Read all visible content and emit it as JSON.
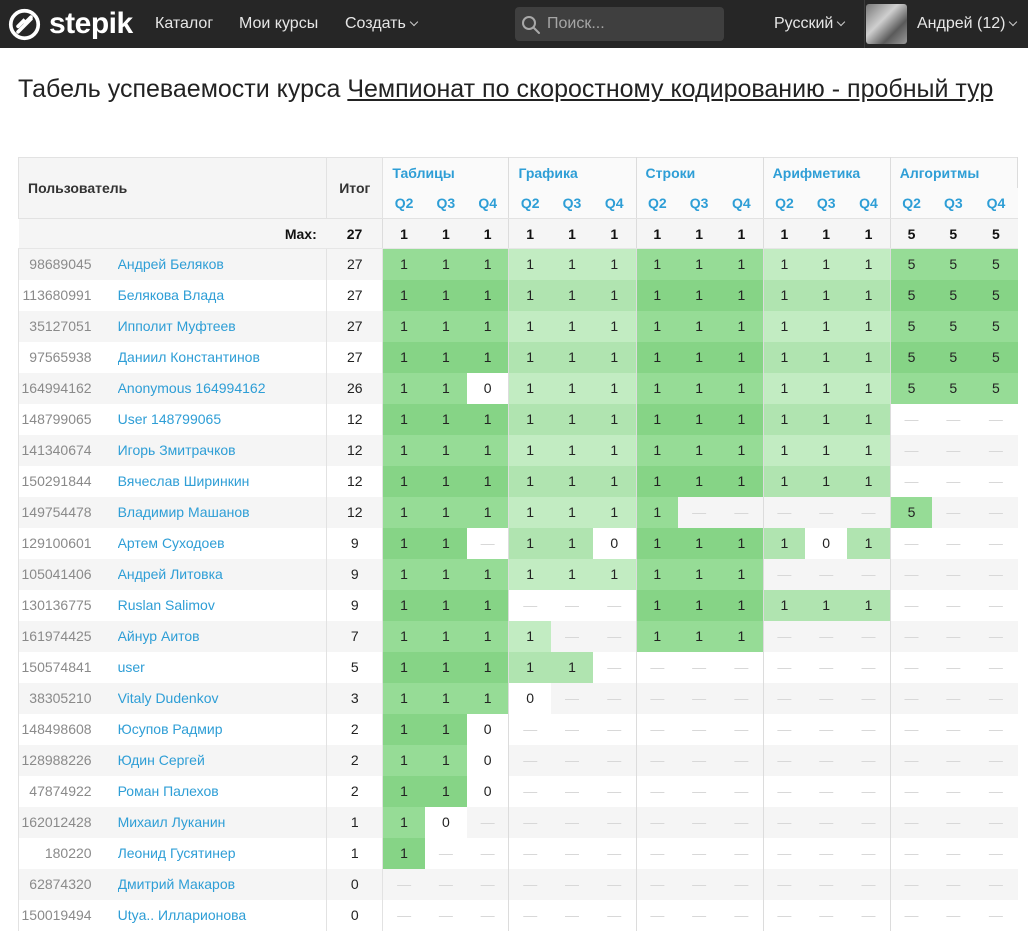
{
  "header": {
    "logo_text": "stepik",
    "nav": {
      "catalog": "Каталог",
      "my_courses": "Мои курсы",
      "create": "Создать"
    },
    "search": {
      "placeholder": "Поиск..."
    },
    "language": "Русский",
    "user_name": "Андрей (12)"
  },
  "page": {
    "title_prefix": "Табель успеваемости курса ",
    "course_title": "Чемпионат по скоростному кодированию - пробный тур"
  },
  "table": {
    "col_user": "Пользователь",
    "col_total": "Итог",
    "max_label": "Max:",
    "max_total": "27",
    "empty_mark": "—",
    "modules": [
      {
        "name": "Таблицы",
        "steps": [
          "Q2",
          "Q3",
          "Q4"
        ],
        "max": [
          "1",
          "1",
          "1"
        ]
      },
      {
        "name": "Графика",
        "steps": [
          "Q2",
          "Q3",
          "Q4"
        ],
        "max": [
          "1",
          "1",
          "1"
        ]
      },
      {
        "name": "Строки",
        "steps": [
          "Q2",
          "Q3",
          "Q4"
        ],
        "max": [
          "1",
          "1",
          "1"
        ]
      },
      {
        "name": "Арифметика",
        "steps": [
          "Q2",
          "Q3",
          "Q4"
        ],
        "max": [
          "1",
          "1",
          "1"
        ]
      },
      {
        "name": "Алгоритмы",
        "steps": [
          "Q2",
          "Q3",
          "Q4"
        ],
        "max": [
          "5",
          "5",
          "5"
        ]
      }
    ],
    "rows": [
      {
        "id": "98689045",
        "name": "Андрей Беляков",
        "total": "27",
        "scores": [
          "1",
          "1",
          "1",
          "1",
          "1",
          "1",
          "1",
          "1",
          "1",
          "1",
          "1",
          "1",
          "5",
          "5",
          "5"
        ]
      },
      {
        "id": "113680991",
        "name": "Белякова Влада",
        "total": "27",
        "scores": [
          "1",
          "1",
          "1",
          "1",
          "1",
          "1",
          "1",
          "1",
          "1",
          "1",
          "1",
          "1",
          "5",
          "5",
          "5"
        ]
      },
      {
        "id": "35127051",
        "name": "Ипполит Муфтеев",
        "total": "27",
        "scores": [
          "1",
          "1",
          "1",
          "1",
          "1",
          "1",
          "1",
          "1",
          "1",
          "1",
          "1",
          "1",
          "5",
          "5",
          "5"
        ]
      },
      {
        "id": "97565938",
        "name": "Даниил Константинов",
        "total": "27",
        "scores": [
          "1",
          "1",
          "1",
          "1",
          "1",
          "1",
          "1",
          "1",
          "1",
          "1",
          "1",
          "1",
          "5",
          "5",
          "5"
        ]
      },
      {
        "id": "164994162",
        "name": "Anonymous 164994162",
        "total": "26",
        "scores": [
          "1",
          "1",
          "0",
          "1",
          "1",
          "1",
          "1",
          "1",
          "1",
          "1",
          "1",
          "1",
          "5",
          "5",
          "5"
        ]
      },
      {
        "id": "148799065",
        "name": "User 148799065",
        "total": "12",
        "scores": [
          "1",
          "1",
          "1",
          "1",
          "1",
          "1",
          "1",
          "1",
          "1",
          "1",
          "1",
          "1",
          "",
          "",
          ""
        ]
      },
      {
        "id": "141340674",
        "name": "Игорь Змитрачков",
        "total": "12",
        "scores": [
          "1",
          "1",
          "1",
          "1",
          "1",
          "1",
          "1",
          "1",
          "1",
          "1",
          "1",
          "1",
          "",
          "",
          ""
        ]
      },
      {
        "id": "150291844",
        "name": "Вячеслав Ширинкин",
        "total": "12",
        "scores": [
          "1",
          "1",
          "1",
          "1",
          "1",
          "1",
          "1",
          "1",
          "1",
          "1",
          "1",
          "1",
          "",
          "",
          ""
        ]
      },
      {
        "id": "149754478",
        "name": "Владимир Машанов",
        "total": "12",
        "scores": [
          "1",
          "1",
          "1",
          "1",
          "1",
          "1",
          "1",
          "",
          "",
          "",
          "",
          "",
          "5",
          "",
          ""
        ]
      },
      {
        "id": "129100601",
        "name": "Артем Суходоев",
        "total": "9",
        "scores": [
          "1",
          "1",
          "",
          "1",
          "1",
          "0",
          "1",
          "1",
          "1",
          "1",
          "0",
          "1",
          "",
          "",
          ""
        ]
      },
      {
        "id": "105041406",
        "name": "Андрей Литовка",
        "total": "9",
        "scores": [
          "1",
          "1",
          "1",
          "1",
          "1",
          "1",
          "1",
          "1",
          "1",
          "",
          "",
          "",
          "",
          "",
          ""
        ]
      },
      {
        "id": "130136775",
        "name": "Ruslan Salimov",
        "total": "9",
        "scores": [
          "1",
          "1",
          "1",
          "",
          "",
          "",
          "1",
          "1",
          "1",
          "1",
          "1",
          "1",
          "",
          "",
          ""
        ]
      },
      {
        "id": "161974425",
        "name": "Айнур Аитов",
        "total": "7",
        "scores": [
          "1",
          "1",
          "1",
          "1",
          "",
          "",
          "1",
          "1",
          "1",
          "",
          "",
          "",
          "",
          "",
          ""
        ]
      },
      {
        "id": "150574841",
        "name": "user",
        "total": "5",
        "scores": [
          "1",
          "1",
          "1",
          "1",
          "1",
          "",
          "",
          "",
          "",
          "",
          "",
          "",
          "",
          "",
          ""
        ]
      },
      {
        "id": "38305210",
        "name": "Vitaly Dudenkov",
        "total": "3",
        "scores": [
          "1",
          "1",
          "1",
          "0",
          "",
          "",
          "",
          "",
          "",
          "",
          "",
          "",
          "",
          "",
          ""
        ]
      },
      {
        "id": "148498608",
        "name": "Юсупов Радмир",
        "total": "2",
        "scores": [
          "1",
          "1",
          "0",
          "",
          "",
          "",
          "",
          "",
          "",
          "",
          "",
          "",
          "",
          "",
          ""
        ]
      },
      {
        "id": "128988226",
        "name": "Юдин Сергей",
        "total": "2",
        "scores": [
          "1",
          "1",
          "0",
          "",
          "",
          "",
          "",
          "",
          "",
          "",
          "",
          "",
          "",
          "",
          ""
        ]
      },
      {
        "id": "47874922",
        "name": "Роман Палехов",
        "total": "2",
        "scores": [
          "1",
          "1",
          "0",
          "",
          "",
          "",
          "",
          "",
          "",
          "",
          "",
          "",
          "",
          "",
          ""
        ]
      },
      {
        "id": "162012428",
        "name": "Михаил Луканин",
        "total": "1",
        "scores": [
          "1",
          "0",
          "",
          "",
          "",
          "",
          "",
          "",
          "",
          "",
          "",
          "",
          "",
          "",
          ""
        ]
      },
      {
        "id": "180220",
        "name": "Леонид Гусятинер",
        "total": "1",
        "scores": [
          "1",
          "",
          "",
          "",
          "",
          "",
          "",
          "",
          "",
          "",
          "",
          "",
          "",
          "",
          ""
        ]
      },
      {
        "id": "62874320",
        "name": "Дмитрий Макаров",
        "total": "0",
        "scores": [
          "",
          "",
          "",
          "",
          "",
          "",
          "",
          "",
          "",
          "",
          "",
          "",
          "",
          "",
          ""
        ]
      },
      {
        "id": "150019494",
        "name": "Utya.. Илларионова",
        "total": "0",
        "scores": [
          "",
          "",
          "",
          "",
          "",
          "",
          "",
          "",
          "",
          "",
          "",
          "",
          "",
          "",
          ""
        ]
      }
    ]
  },
  "colors": {
    "topbar": "#262626",
    "link": "#2e9ed6",
    "cell_full_dark": "#8dd98d",
    "cell_full_light": "#bdeabd"
  }
}
